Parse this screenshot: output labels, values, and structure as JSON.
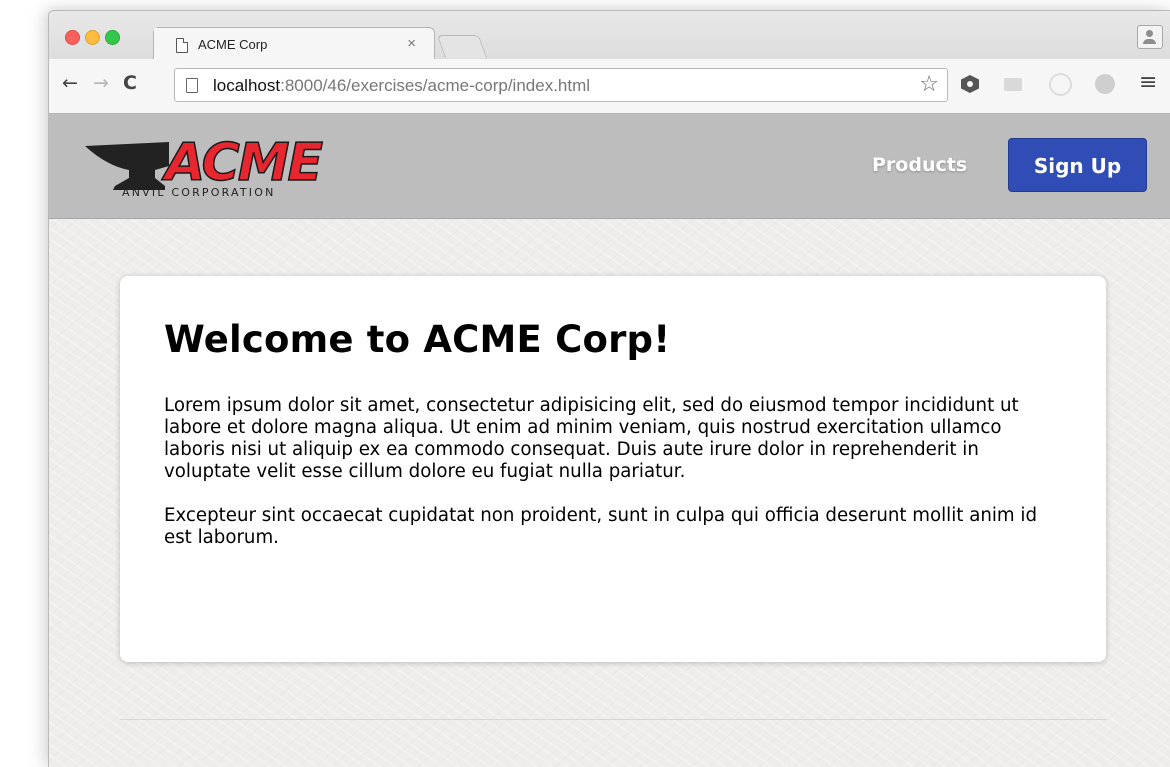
{
  "browser": {
    "tab": {
      "title": "ACME Corp",
      "close": "×"
    },
    "nav": {
      "back": "←",
      "forward": "→",
      "reload": "C"
    },
    "omnibox": {
      "url_host": "localhost",
      "url_rest": ":8000/46/exercises/acme-corp/index.html",
      "star": "☆"
    },
    "menu": "≡"
  },
  "site": {
    "logo": {
      "wordmark": "ACME",
      "tagline": "ANVIL CORPORATION"
    },
    "nav": {
      "products": "Products",
      "signup": "Sign Up"
    }
  },
  "main": {
    "heading": "Welcome to ACME Corp!",
    "paragraphs": [
      "Lorem ipsum dolor sit amet, consectetur adipisicing elit, sed do eiusmod tempor incididunt ut labore et dolore magna aliqua. Ut enim ad minim veniam, quis nostrud exercitation ullamco laboris nisi ut aliquip ex ea commodo consequat. Duis aute irure dolor in reprehenderit in voluptate velit esse cillum dolore eu fugiat nulla pariatur.",
      "Excepteur sint occaecat cupidatat non proident, sunt in culpa qui officia deserunt mollit anim id est laborum."
    ]
  },
  "colors": {
    "brand_red": "#e8262f",
    "header_gray": "#bdbdbd",
    "signup_blue": "#2f4db4"
  }
}
